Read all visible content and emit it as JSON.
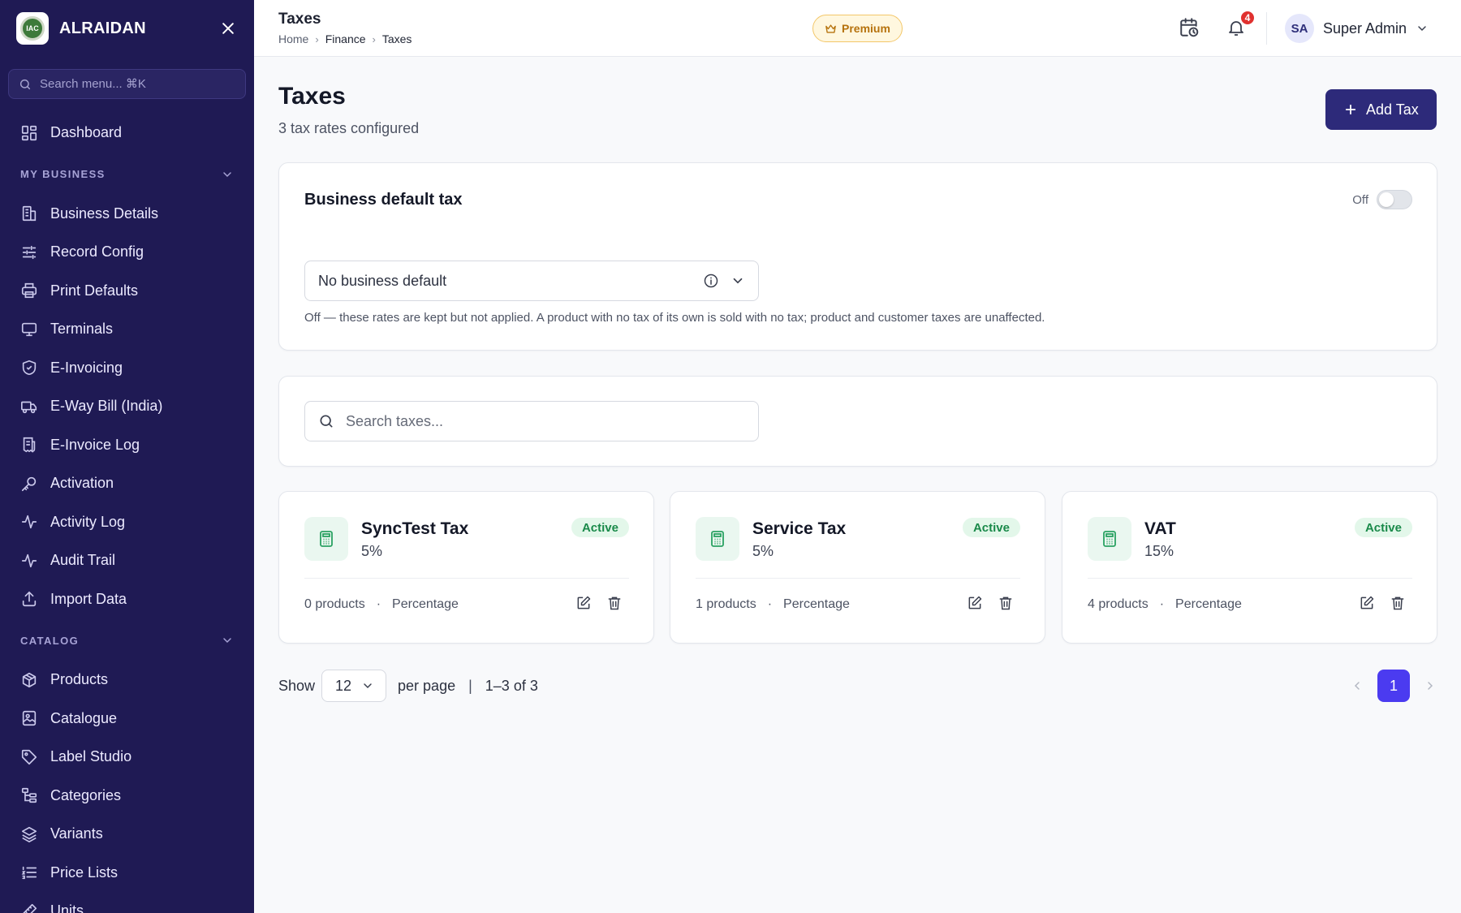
{
  "brand": {
    "name": "ALRAIDAN",
    "logo_text": "IAC"
  },
  "sidebar": {
    "search_placeholder": "Search menu... ⌘K",
    "top_items": [
      {
        "label": "Dashboard",
        "icon": "dashboard-icon"
      }
    ],
    "sections": [
      {
        "title": "MY BUSINESS",
        "items": [
          {
            "label": "Business Details",
            "icon": "building-icon"
          },
          {
            "label": "Record Config",
            "icon": "sliders-icon"
          },
          {
            "label": "Print Defaults",
            "icon": "printer-icon"
          },
          {
            "label": "Terminals",
            "icon": "monitor-icon"
          },
          {
            "label": "E-Invoicing",
            "icon": "shield-check-icon"
          },
          {
            "label": "E-Way Bill (India)",
            "icon": "truck-icon"
          },
          {
            "label": "E-Invoice Log",
            "icon": "receipt-icon"
          },
          {
            "label": "Activation",
            "icon": "key-icon"
          },
          {
            "label": "Activity Log",
            "icon": "activity-icon"
          },
          {
            "label": "Audit Trail",
            "icon": "activity-icon"
          },
          {
            "label": "Import Data",
            "icon": "upload-icon"
          }
        ]
      },
      {
        "title": "CATALOG",
        "items": [
          {
            "label": "Products",
            "icon": "package-icon"
          },
          {
            "label": "Catalogue",
            "icon": "image-icon"
          },
          {
            "label": "Label Studio",
            "icon": "tag-icon"
          },
          {
            "label": "Categories",
            "icon": "categories-icon"
          },
          {
            "label": "Variants",
            "icon": "layers-icon"
          },
          {
            "label": "Price Lists",
            "icon": "list-icon"
          },
          {
            "label": "Units",
            "icon": "ruler-icon"
          }
        ]
      }
    ]
  },
  "topbar": {
    "title": "Taxes",
    "breadcrumb": [
      "Home",
      "Finance",
      "Taxes"
    ],
    "premium_label": "Premium",
    "notification_count": "4",
    "user": {
      "initials": "SA",
      "name": "Super Admin"
    }
  },
  "page": {
    "title": "Taxes",
    "subtitle": "3 tax rates configured",
    "add_button": "Add Tax"
  },
  "default_tax": {
    "title": "Business default tax",
    "toggle_label": "Off",
    "toggle_on": false,
    "select_value": "No business default",
    "help_text": "Off — these rates are kept but not applied. A product with no tax of its own is sold with no tax; product and customer taxes are unaffected."
  },
  "search": {
    "placeholder": "Search taxes..."
  },
  "taxes": [
    {
      "name": "SyncTest Tax",
      "rate": "5%",
      "status": "Active",
      "products": "0 products",
      "type": "Percentage"
    },
    {
      "name": "Service Tax",
      "rate": "5%",
      "status": "Active",
      "products": "1 products",
      "type": "Percentage"
    },
    {
      "name": "VAT",
      "rate": "15%",
      "status": "Active",
      "products": "4 products",
      "type": "Percentage"
    }
  ],
  "pagination": {
    "show_label": "Show",
    "per_page_value": "12",
    "per_page_label": "per page",
    "separator": "|",
    "range": "1–3 of 3",
    "current_page": "1"
  },
  "colors": {
    "sidebar_bg": "#1f1a54",
    "primary_button": "#2d2a7a",
    "active_page": "#4b3bf0",
    "status_active": "#1a8a4a",
    "premium": "#b6720d"
  }
}
